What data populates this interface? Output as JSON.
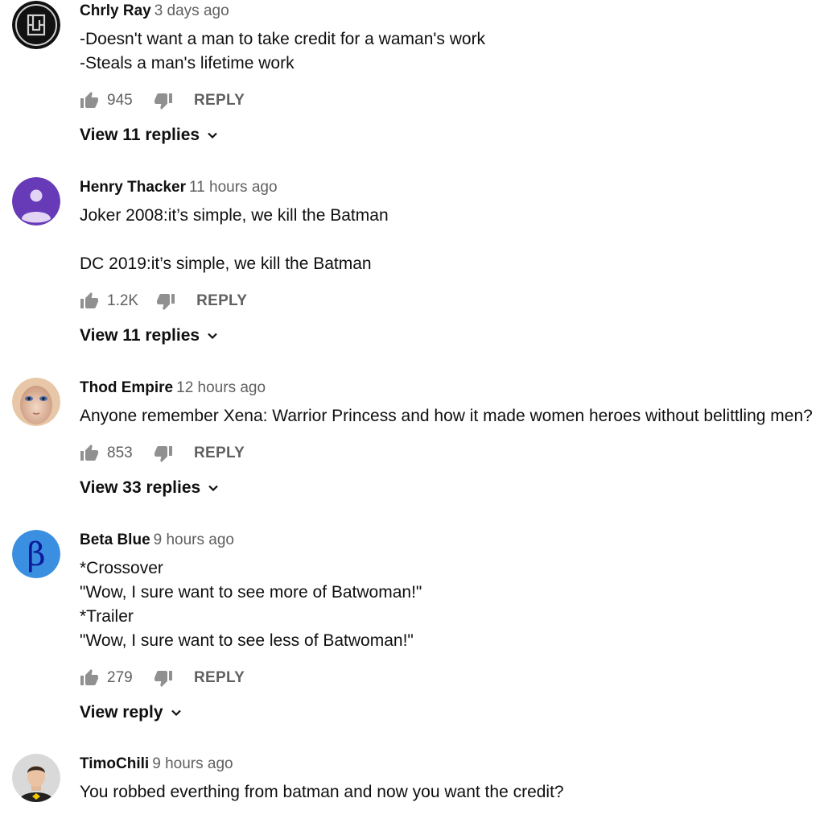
{
  "comments": [
    {
      "author": "Chrly Ray",
      "time": "3 days ago",
      "lines": [
        "-Doesn't want a man to take credit for a waman's work",
        "-Steals a man's lifetime work"
      ],
      "likes": "945",
      "reply_label": "REPLY",
      "view_replies": "View 11 replies",
      "avatar_icon": "band-logo-avatar"
    },
    {
      "author": "Henry Thacker",
      "time": "11 hours ago",
      "lines": [
        "Joker 2008:it’s simple, we kill the Batman",
        "",
        "DC 2019:it’s simple, we kill the Batman"
      ],
      "likes": "1.2K",
      "reply_label": "REPLY",
      "view_replies": "View 11 replies",
      "avatar_icon": "default-person-avatar"
    },
    {
      "author": "Thod Empire",
      "time": "12 hours ago",
      "lines": [
        "Anyone remember Xena: Warrior Princess and how it made women heroes without belittling men?"
      ],
      "likes": "853",
      "reply_label": "REPLY",
      "view_replies": "View 33 replies",
      "avatar_icon": "face-avatar"
    },
    {
      "author": "Beta Blue",
      "time": "9 hours ago",
      "lines": [
        "*Crossover",
        "\"Wow, I sure want to see more of Batwoman!\"",
        "*Trailer",
        "\"Wow, I sure want to see less of Batwoman!\""
      ],
      "likes": "279",
      "reply_label": "REPLY",
      "view_replies": "View reply",
      "avatar_icon": "beta-letter-avatar",
      "avatar_letter": "β"
    },
    {
      "author": "TimoChili",
      "time": "9 hours ago",
      "lines": [
        "You robbed everthing from batman and now you want the credit?"
      ],
      "likes": "",
      "reply_label": "",
      "view_replies": "",
      "avatar_icon": "photo-avatar"
    }
  ],
  "colors": {
    "text": "#0f0f0f",
    "secondary": "#606060",
    "icon": "#909090",
    "default_avatar": "#673ab7",
    "beta_avatar": "#3b8fe0"
  }
}
